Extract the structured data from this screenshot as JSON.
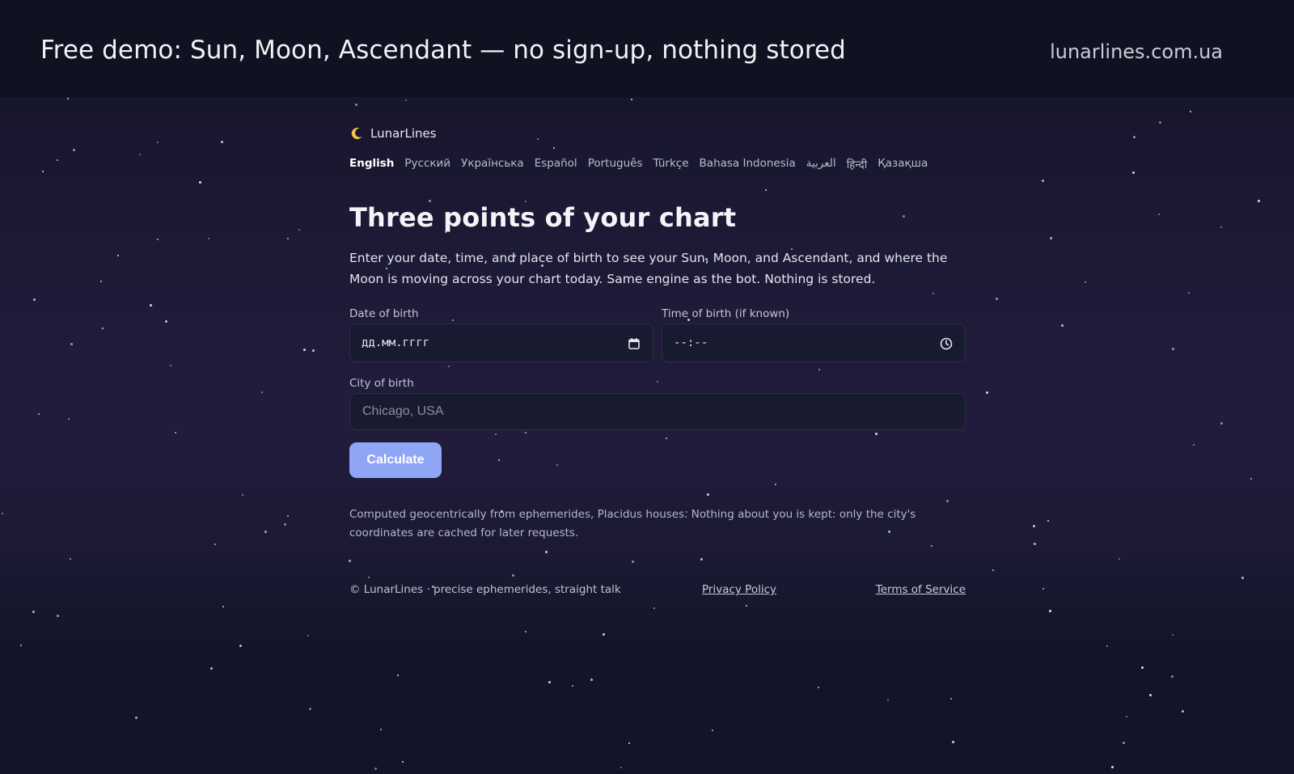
{
  "banner": {
    "text": "Free demo: Sun, Moon, Ascendant — no sign-up, nothing stored",
    "domain": "lunarlines.com.ua"
  },
  "brand": {
    "icon": "crescent-moon-icon",
    "name": "LunarLines"
  },
  "languages": [
    {
      "label": "English",
      "active": true
    },
    {
      "label": "Русский",
      "active": false
    },
    {
      "label": "Українська",
      "active": false
    },
    {
      "label": "Español",
      "active": false
    },
    {
      "label": "Português",
      "active": false
    },
    {
      "label": "Türkçe",
      "active": false
    },
    {
      "label": "Bahasa Indonesia",
      "active": false
    },
    {
      "label": "العربية",
      "active": false
    },
    {
      "label": "हिन्दी",
      "active": false
    },
    {
      "label": "Қазақша",
      "active": false
    }
  ],
  "main": {
    "title": "Three points of your chart",
    "intro": "Enter your date, time, and place of birth to see your Sun, Moon, and Ascendant, and where the Moon is moving across your chart today. Same engine as the bot. Nothing is stored."
  },
  "form": {
    "date": {
      "label": "Date of birth",
      "value": "дд.мм.гггг",
      "icon": "calendar-icon"
    },
    "time": {
      "label": "Time of birth (if known)",
      "value": "--:--",
      "icon": "clock-icon"
    },
    "city": {
      "label": "City of birth",
      "placeholder": "Chicago, USA",
      "value": ""
    },
    "submit_label": "Calculate"
  },
  "note": "Computed geocentrically from ephemerides, Placidus houses. Nothing about you is kept: only the city's coordinates are cached for later requests.",
  "footer": {
    "copyright": "© LunarLines · precise ephemerides, straight talk",
    "privacy_label": "Privacy Policy",
    "terms_label": "Terms of Service"
  },
  "colors": {
    "background": "#1d1a36",
    "accent_button": "#8fa6f5",
    "input_bg": "#181a30"
  }
}
